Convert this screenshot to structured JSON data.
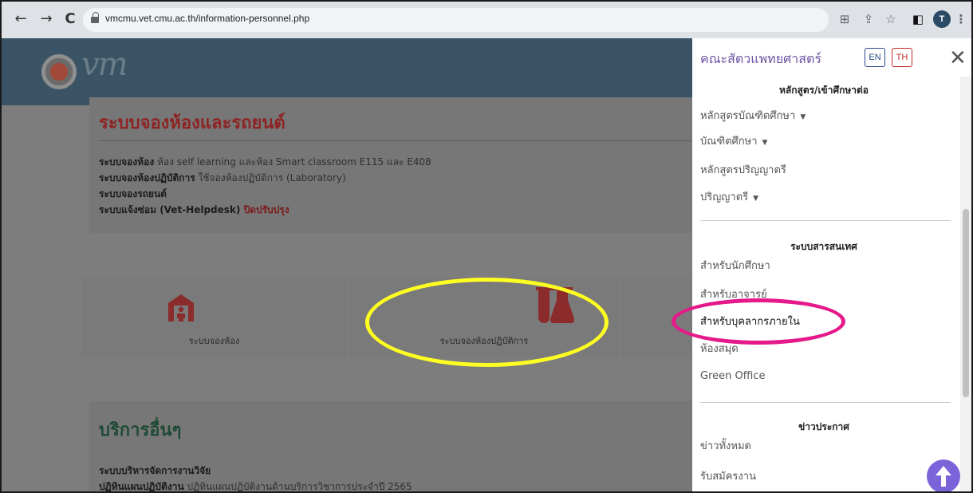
{
  "browser": {
    "url": "vmcmu.vet.cmu.ac.th/information-personnel.php",
    "back": "←",
    "forward": "→",
    "reload": "C",
    "avatar": "T"
  },
  "page": {
    "logo_text": "vm",
    "booking": {
      "title": "ระบบจองห้องและรถยนต์",
      "lines": [
        {
          "bold": "ระบบจองห้อง",
          "text": " ห้อง self learning และห้อง Smart classroom E115 และ E408"
        },
        {
          "bold": "ระบบจองห้องปฏิบัติการ",
          "text": " ใช้จองห้องปฏิบัติการ (Laboratory)"
        },
        {
          "bold": "ระบบจองรถยนต์",
          "text": ""
        },
        {
          "bold": "ระบบแจ้งซ่อม (Vet-Helpdesk)",
          "text": " ปิดปรับปรุง"
        }
      ]
    },
    "tiles": [
      {
        "label": "ระบบจองห้อง"
      },
      {
        "label": "ระบบจองห้องปฏิบัติการ"
      }
    ],
    "other": {
      "title": "บริการอื่นๆ",
      "lines": [
        {
          "bold": "ระบบบริหารจัดการงานวิจัย",
          "text": ""
        },
        {
          "bold": "ปฏิทินแผนปฏิบัติงาน",
          "text": " ปฏิทินแผนปฏิบัติงานด้านบริการวิชาการประจำปี 2565"
        }
      ]
    }
  },
  "sidebar": {
    "title": "คณะสัตวแพทยศาสตร์",
    "lang_en": "EN",
    "lang_th": "TH",
    "close": "✕",
    "sections": [
      {
        "title": "หลักสูตร/เข้าศึกษาต่อ",
        "items": [
          "หลักสูตรบัณฑิตศึกษา",
          "บัณฑิตศึกษา",
          "หลักสูตรปริญญาตรี",
          "ปริญญาตรี"
        ]
      },
      {
        "title": "ระบบสารสนเทศ",
        "items": [
          "สำหรับนักศึกษา",
          "สำหรับอาจารย์",
          "สำหรับบุคลากรภายใน",
          "ห้องสมุด",
          "Green Office"
        ]
      },
      {
        "title": "ข่าวประกาศ",
        "items": [
          "ข่าวทั้งหมด",
          "รับสมัครงาน"
        ]
      }
    ]
  }
}
